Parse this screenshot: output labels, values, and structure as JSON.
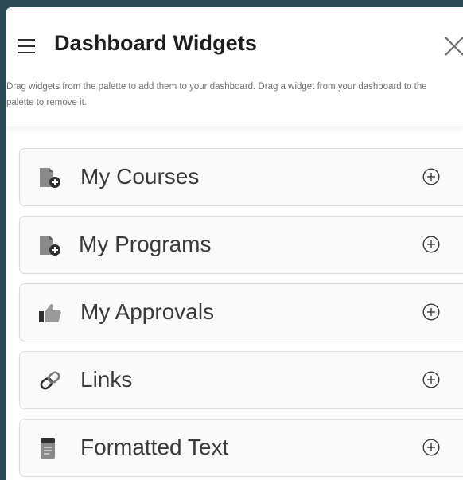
{
  "header": {
    "title": "Dashboard Widgets",
    "description": "Drag widgets from the palette to add them to your dashboard. Drag a widget from your dashboard to the palette to remove it."
  },
  "widgets": [
    {
      "label": "My Courses",
      "icon": "document-add-icon"
    },
    {
      "label": "My Programs",
      "icon": "document-add-icon"
    },
    {
      "label": "My Approvals",
      "icon": "thumbs-up-icon"
    },
    {
      "label": "Links",
      "icon": "link-icon"
    },
    {
      "label": "Formatted Text",
      "icon": "formatted-text-icon"
    }
  ],
  "colors": {
    "window_frame": "#2b4a55",
    "icon_gray": "#8a8a8a",
    "text": "#3a3a3a"
  }
}
